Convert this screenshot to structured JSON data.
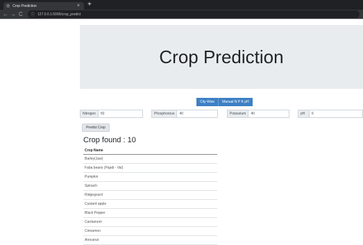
{
  "browser": {
    "tab_title": "Crop Prediction",
    "tab_close": "×",
    "new_tab": "+",
    "back": "←",
    "forward": "→",
    "reload": "C",
    "info": "ⓘ",
    "url": "127.0.0.1:5000/crop_predict"
  },
  "header": {
    "title": "Crop Prediction"
  },
  "mode_buttons": [
    "City Wise",
    "Manual N P K pH"
  ],
  "fields": [
    {
      "label": "Nitrogen",
      "value": "50"
    },
    {
      "label": "Phosphorous",
      "value": "40"
    },
    {
      "label": "Potassium",
      "value": "40"
    },
    {
      "label": "pH",
      "value": "6"
    }
  ],
  "predict_button": "Predict Crop",
  "result": {
    "found_label": "Crop found : 10",
    "column_header": "Crop Name",
    "crops": [
      "Barley(Jaw)",
      "Faba beans (Papdi - Val)",
      "Pumpkin",
      "Spinach",
      "Ridgegourd",
      "Custard apple",
      "Black Pepper",
      "Cardamom",
      "Cinnamon",
      "Arecanut"
    ]
  }
}
